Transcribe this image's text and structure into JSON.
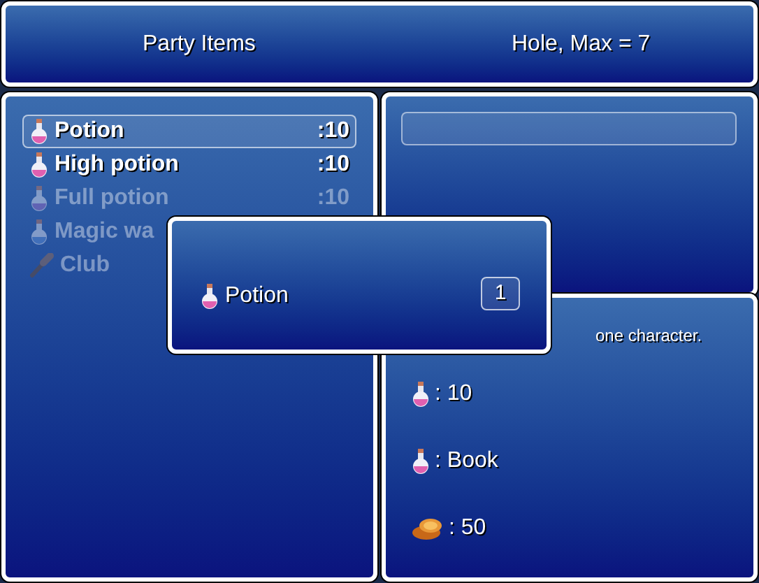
{
  "header": {
    "title": "Party Items",
    "info": "Hole, Max = 7"
  },
  "items": [
    {
      "name": "Potion",
      "count": ":10",
      "kind": "potion",
      "selected": true,
      "disabled": false
    },
    {
      "name": "High potion",
      "count": ":10",
      "kind": "potion",
      "selected": false,
      "disabled": false
    },
    {
      "name": "Full potion",
      "count": ":10",
      "kind": "potion",
      "selected": false,
      "disabled": true
    },
    {
      "name": "Magic wa",
      "kind": "water",
      "selected": false,
      "disabled": true
    },
    {
      "name": "Club",
      "kind": "club",
      "selected": false,
      "disabled": true
    }
  ],
  "quantity_dialog": {
    "item": "Potion",
    "kind": "potion",
    "quantity": "1"
  },
  "description": "one character.",
  "stats": [
    {
      "kind": "potion",
      "value": ": 10"
    },
    {
      "kind": "potion",
      "value": ": Book"
    },
    {
      "kind": "coin",
      "value": ": 50"
    }
  ]
}
